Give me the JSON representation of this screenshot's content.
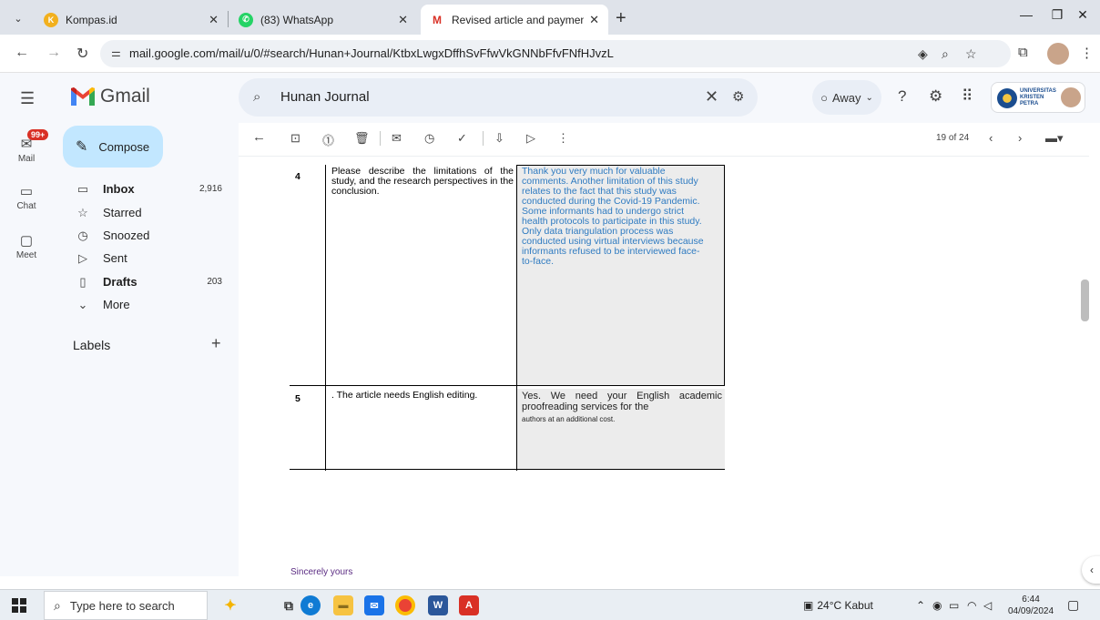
{
  "browser": {
    "tabs": [
      {
        "title": "Kompas.id",
        "active": false
      },
      {
        "title": "(83) WhatsApp",
        "active": false
      },
      {
        "title": "Revised article and payment pro",
        "active": true
      }
    ],
    "url": "mail.google.com/mail/u/0/#search/Hunan+Journal/KtbxLwgxDffhSvFfwVkGNNbFfvFNfHJvzL"
  },
  "gmail": {
    "brand": "Gmail",
    "search_value": "Hunan Journal",
    "status": "Away",
    "org_name": "UNIVERSITAS\nKRISTEN\nPETRA",
    "mail_badge": "99+",
    "rail": [
      {
        "label": "Mail"
      },
      {
        "label": "Chat"
      },
      {
        "label": "Meet"
      }
    ],
    "compose_label": "Compose",
    "nav": [
      {
        "label": "Inbox",
        "count": "2,916",
        "bold": true
      },
      {
        "label": "Starred",
        "count": "",
        "bold": false
      },
      {
        "label": "Snoozed",
        "count": "",
        "bold": false
      },
      {
        "label": "Sent",
        "count": "",
        "bold": false
      },
      {
        "label": "Drafts",
        "count": "203",
        "bold": true
      },
      {
        "label": "More",
        "count": "",
        "bold": false
      }
    ],
    "labels_title": "Labels",
    "page_count": "19 of 24"
  },
  "email": {
    "rows": [
      {
        "num": "4",
        "comment": "Please describe the limitations of the study, and the research perspectives in the conclusion.",
        "response": "Thank you very much for valuable comments.  Another limitation of this study relates to the fact that this study was conducted during the Covid-19 Pandemic. Some informants had to undergo strict health protocols to participate in this study. Only data triangulation process was conducted using virtual interviews because informants refused to be interviewed face-to-face."
      },
      {
        "num": "5",
        "comment": ". The article needs English editing.",
        "response_line1": "Yes. We need your English academic proofreading services for the",
        "response_line2": "authors at an additional cost."
      }
    ],
    "closing": "Sincerely yours"
  },
  "taskbar": {
    "search_placeholder": "Type here to search",
    "weather": "24°C  Kabut",
    "time": "6:44",
    "date": "04/09/2024"
  },
  "colors": {
    "compose_bg": "#c2e7ff",
    "answer_text": "#2f7bc1",
    "badge_red": "#d93025"
  }
}
